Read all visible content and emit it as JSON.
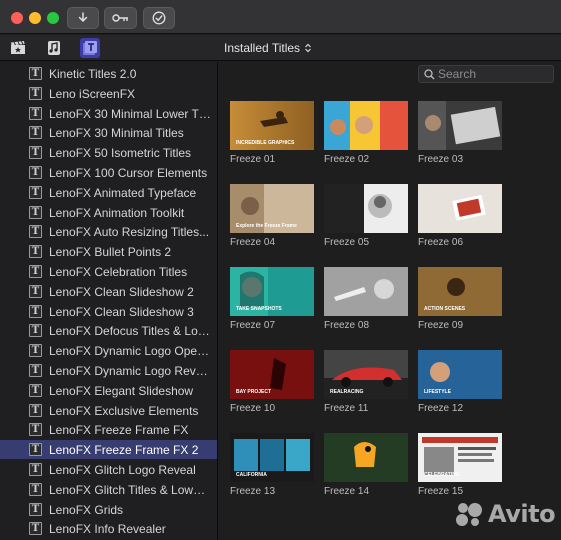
{
  "toolbar": {
    "title_menu": "Installed Titles"
  },
  "search": {
    "placeholder": "Search"
  },
  "sidebar": {
    "items": [
      {
        "label": "Kinetic Titles 2.0"
      },
      {
        "label": "Leno iScreenFX"
      },
      {
        "label": "LenoFX 30 Minimal Lower Th..."
      },
      {
        "label": "LenoFX 30 Minimal Titles"
      },
      {
        "label": "LenoFX 50 Isometric Titles"
      },
      {
        "label": "LenoFX 100 Cursor Elements"
      },
      {
        "label": "LenoFX Animated Typeface"
      },
      {
        "label": "LenoFX Animation Toolkit"
      },
      {
        "label": "LenoFX Auto Resizing Titles..."
      },
      {
        "label": "LenoFX Bullet Points 2"
      },
      {
        "label": "LenoFX Celebration Titles"
      },
      {
        "label": "LenoFX Clean Slideshow 2"
      },
      {
        "label": "LenoFX Clean Slideshow 3"
      },
      {
        "label": "LenoFX Defocus Titles & Low..."
      },
      {
        "label": "LenoFX Dynamic Logo Open..."
      },
      {
        "label": "LenoFX Dynamic Logo Reveal"
      },
      {
        "label": "LenoFX Elegant Slideshow"
      },
      {
        "label": "LenoFX Exclusive Elements"
      },
      {
        "label": "LenoFX Freeze Frame FX"
      },
      {
        "label": "LenoFX Freeze Frame FX 2",
        "selected": true
      },
      {
        "label": "LenoFX Glitch Logo Reveal"
      },
      {
        "label": "LenoFX Glitch Titles & Lower..."
      },
      {
        "label": "LenoFX Grids"
      },
      {
        "label": "LenoFX Info Revealer"
      }
    ]
  },
  "grid": {
    "items": [
      {
        "caption": "Freeze 01",
        "overlay": "INCREDIBLE GRAPHICS"
      },
      {
        "caption": "Freeze 02",
        "overlay": ""
      },
      {
        "caption": "Freeze 03",
        "overlay": ""
      },
      {
        "caption": "Freeze 04",
        "overlay": "Explore the Freeze Frame"
      },
      {
        "caption": "Freeze 05",
        "overlay": ""
      },
      {
        "caption": "Freeze 06",
        "overlay": ""
      },
      {
        "caption": "Freeze 07",
        "overlay": "TAKE SNAPSHOTS"
      },
      {
        "caption": "Freeze 08",
        "overlay": ""
      },
      {
        "caption": "Freeze 09",
        "overlay": "ACTION SCENES"
      },
      {
        "caption": "Freeze 10",
        "overlay": "BAY PROJECT"
      },
      {
        "caption": "Freeze 11",
        "overlay": "REALRACING"
      },
      {
        "caption": "Freeze 12",
        "overlay": "LIFESTYLE"
      },
      {
        "caption": "Freeze 13",
        "overlay": "CALIFORNIA"
      },
      {
        "caption": "Freeze 14",
        "overlay": ""
      },
      {
        "caption": "Freeze 15",
        "overlay": "CELEBRATING"
      }
    ]
  },
  "watermark": {
    "text": "Avito"
  },
  "colors": {
    "selection": "#373d70",
    "active_tool": "#3d3da8"
  }
}
